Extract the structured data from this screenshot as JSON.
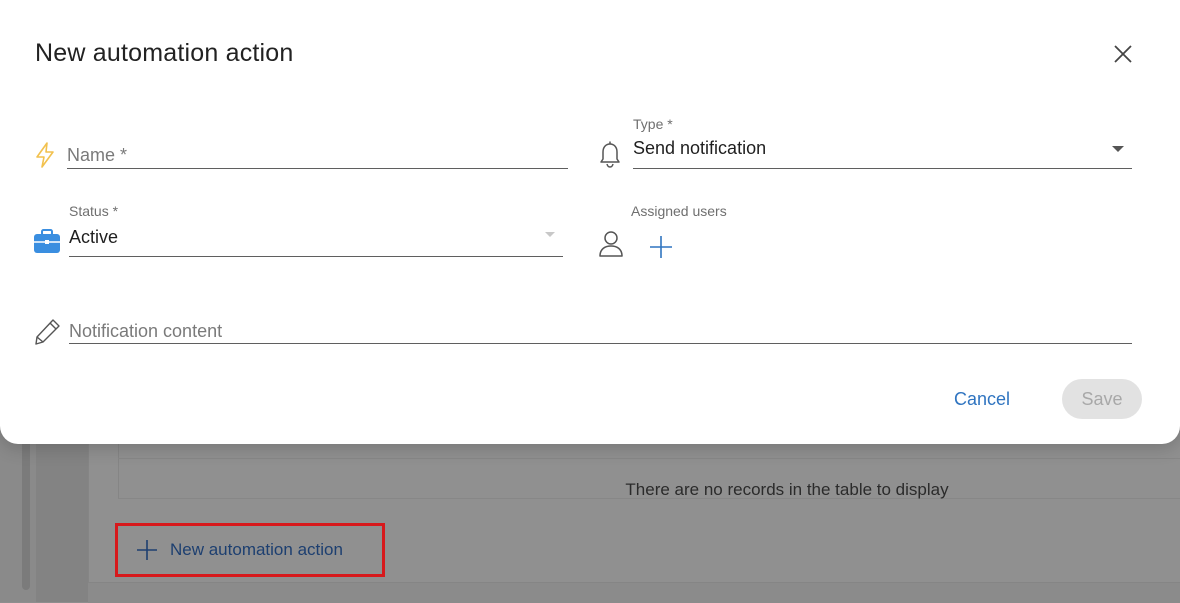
{
  "dialog": {
    "title": "New automation action",
    "close_icon": "close-icon",
    "fields": {
      "name": {
        "placeholder": "Name *",
        "icon": "lightning-icon"
      },
      "type": {
        "label": "Type *",
        "value": "Send notification",
        "icon": "bell-icon"
      },
      "status": {
        "label": "Status *",
        "value": "Active",
        "icon": "briefcase-icon"
      },
      "assigned_users": {
        "label": "Assigned users",
        "icon": "user-icon",
        "add_icon": "plus-icon"
      },
      "notification_content": {
        "placeholder": "Notification content",
        "icon": "pencil-icon"
      }
    },
    "actions": {
      "cancel": "Cancel",
      "save": "Save"
    }
  },
  "background": {
    "empty_table_text": "There are no records in the table to display",
    "new_action_label": "New automation action"
  },
  "colors": {
    "accent": "#2f74c0",
    "briefcase": "#3a8ee0",
    "lightning": "#f2c14e",
    "highlight_border": "#d8191c"
  }
}
